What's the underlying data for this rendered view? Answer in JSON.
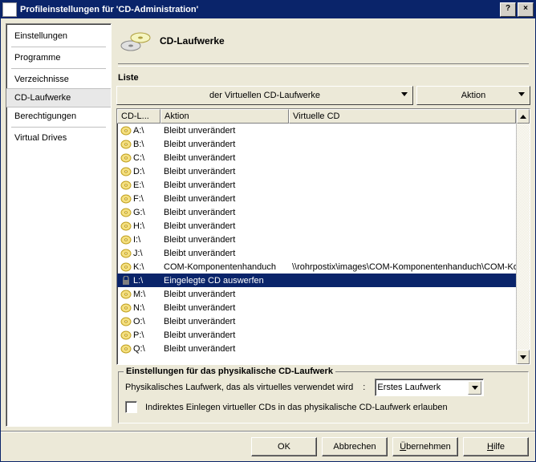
{
  "window": {
    "title": "Profileinstellungen für 'CD-Administration'"
  },
  "titlebar": {
    "help": "?",
    "close": "×"
  },
  "sidebar": {
    "items": [
      {
        "label": "Einstellungen"
      },
      {
        "label": "Programme"
      },
      {
        "label": "Verzeichnisse"
      },
      {
        "label": "CD-Laufwerke",
        "selected": true
      },
      {
        "label": "Berechtigungen"
      },
      {
        "label": "Virtual Drives"
      }
    ]
  },
  "header": {
    "title": "CD-Laufwerke"
  },
  "list": {
    "label": "Liste",
    "dropdown_main": "der Virtuellen CD-Laufwerke",
    "dropdown_action": "Aktion",
    "columns": {
      "drive": "CD-L...",
      "action": "Aktion",
      "vcd": "Virtuelle CD"
    },
    "rows": [
      {
        "drive": "A:\\",
        "action": "Bleibt unverändert",
        "vcd": ""
      },
      {
        "drive": "B:\\",
        "action": "Bleibt unverändert",
        "vcd": ""
      },
      {
        "drive": "C:\\",
        "action": "Bleibt unverändert",
        "vcd": ""
      },
      {
        "drive": "D:\\",
        "action": "Bleibt unverändert",
        "vcd": ""
      },
      {
        "drive": "E:\\",
        "action": "Bleibt unverändert",
        "vcd": ""
      },
      {
        "drive": "F:\\",
        "action": "Bleibt unverändert",
        "vcd": ""
      },
      {
        "drive": "G:\\",
        "action": "Bleibt unverändert",
        "vcd": ""
      },
      {
        "drive": "H:\\",
        "action": "Bleibt unverändert",
        "vcd": ""
      },
      {
        "drive": "I:\\",
        "action": "Bleibt unverändert",
        "vcd": ""
      },
      {
        "drive": "J:\\",
        "action": "Bleibt unverändert",
        "vcd": ""
      },
      {
        "drive": "K:\\",
        "action": "COM-Komponentenhanduch",
        "vcd": "\\\\rohrpostix\\images\\COM-Komponentenhanduch\\COM-Kom"
      },
      {
        "drive": "L:\\",
        "action": "Eingelegte CD auswerfen",
        "vcd": "",
        "selected": true,
        "locked": true
      },
      {
        "drive": "M:\\",
        "action": "Bleibt unverändert",
        "vcd": ""
      },
      {
        "drive": "N:\\",
        "action": "Bleibt unverändert",
        "vcd": ""
      },
      {
        "drive": "O:\\",
        "action": "Bleibt unverändert",
        "vcd": ""
      },
      {
        "drive": "P:\\",
        "action": "Bleibt unverändert",
        "vcd": ""
      },
      {
        "drive": "Q:\\",
        "action": "Bleibt unverändert",
        "vcd": ""
      }
    ]
  },
  "physical": {
    "legend": "Einstellungen für das physikalische CD-Laufwerk",
    "label": "Physikalisches Laufwerk, das als virtuelles verwendet wird",
    "select_value": "Erstes Laufwerk",
    "checkbox_label": "Indirektes Einlegen virtueller CDs in das physikalische CD-Laufwerk erlauben"
  },
  "buttons": {
    "ok": "OK",
    "cancel_pre": "Abbrechen",
    "apply_pre": "Ü",
    "apply_post": "bernehmen",
    "help_pre": "H",
    "help_post": "ilfe"
  }
}
